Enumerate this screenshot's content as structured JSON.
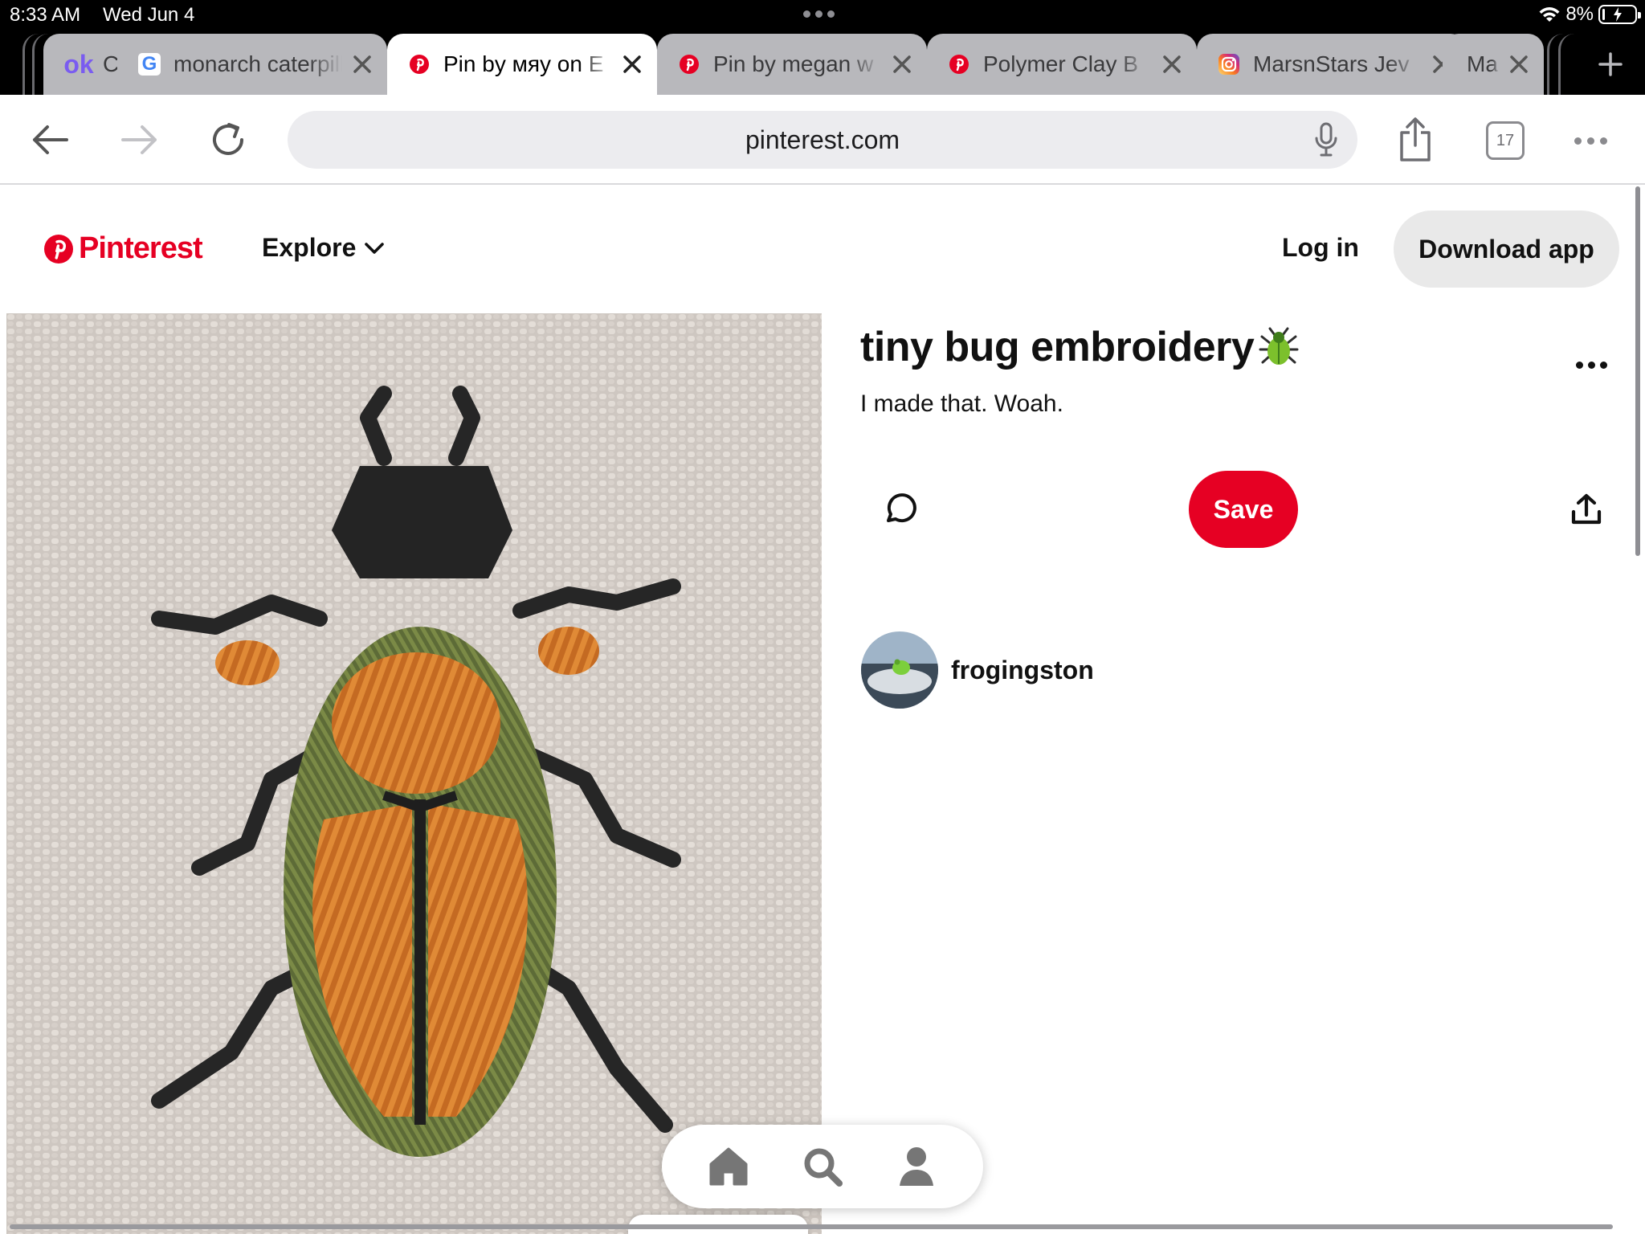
{
  "status_bar": {
    "time": "8:33 AM",
    "date": "Wed Jun 4",
    "battery_text": "8%",
    "battery_level": 0.08,
    "icons": [
      "multitask-dots-icon",
      "wifi-icon",
      "battery-charging-icon"
    ]
  },
  "tabs": [
    {
      "favicon": "ok-icon",
      "favicon_text": "ok",
      "title": "C",
      "active": false
    },
    {
      "favicon": "google-icon",
      "favicon_text": "G",
      "title": "monarch caterpillar",
      "active": false
    },
    {
      "favicon": "pinterest-icon",
      "title": "Pin by мяу on E",
      "active": true
    },
    {
      "favicon": "pinterest-icon",
      "title": "Pin by megan w",
      "active": false
    },
    {
      "favicon": "pinterest-icon",
      "title": "Polymer Clay B",
      "active": false
    },
    {
      "favicon": "instagram-icon",
      "title": "MarsnStars Jev",
      "active": false
    },
    {
      "favicon": "",
      "title": "Mai",
      "active": false
    }
  ],
  "toolbar": {
    "url": "pinterest.com",
    "tab_count": "17",
    "icons": [
      "back-arrow-icon",
      "forward-arrow-icon",
      "reload-icon",
      "microphone-icon",
      "share-icon",
      "more-dots-icon"
    ]
  },
  "header": {
    "brand": "Pinterest",
    "explore": "Explore",
    "login": "Log in",
    "download": "Download app",
    "brand_color": "#e60023"
  },
  "pin": {
    "image_subject": "embroidered-beetle",
    "title": "tiny bug embroidery",
    "title_emoji": "beetle-icon",
    "description": "I made that. Woah.",
    "save": "Save",
    "username": "frogingston"
  },
  "bottom_nav": [
    "home-icon",
    "search-icon",
    "profile-icon"
  ],
  "colors": {
    "accent": "#e60023",
    "tab_bar": "#000000",
    "inactive_tab": "#b8b8bc",
    "urlbar_bg": "#ececef",
    "pill_button": "#e9e9e9"
  }
}
